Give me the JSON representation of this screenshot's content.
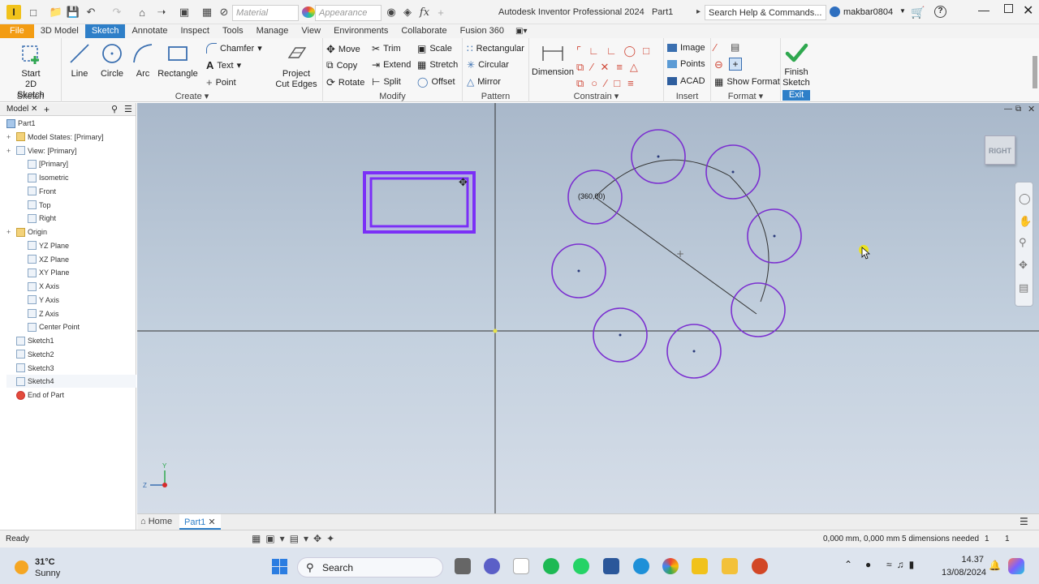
{
  "window": {
    "title": "Autodesk Inventor Professional 2024",
    "doc_name": "Part1",
    "search_placeholder": "Search Help & Commands...",
    "user": "makbar0804",
    "help": "?"
  },
  "quick_access": {
    "material_placeholder": "Material",
    "appearance_placeholder": "Appearance",
    "fx_label": "fx"
  },
  "menu_tabs": [
    "File",
    "3D Model",
    "Sketch",
    "Annotate",
    "Inspect",
    "Tools",
    "Manage",
    "View",
    "Environments",
    "Collaborate",
    "Fusion 360"
  ],
  "ribbon": {
    "sketch_group": {
      "title": "Sketch",
      "start_line1": "Start",
      "start_line2": "2D Sketch"
    },
    "create_group": {
      "title": "Create",
      "line": "Line",
      "circle": "Circle",
      "arc": "Arc",
      "rectangle": "Rectangle",
      "chamfer": "Chamfer",
      "text": "Text",
      "point": "Point",
      "project_line1": "Project",
      "project_line2": "Cut Edges"
    },
    "modify_group": {
      "title": "Modify",
      "move": "Move",
      "copy": "Copy",
      "rotate": "Rotate",
      "trim": "Trim",
      "extend": "Extend",
      "split": "Split",
      "scale": "Scale",
      "stretch": "Stretch",
      "offset": "Offset"
    },
    "pattern_group": {
      "title": "Pattern",
      "rectangular": "Rectangular",
      "circular": "Circular",
      "mirror": "Mirror"
    },
    "constrain_group": {
      "title": "Constrain",
      "dimension": "Dimension"
    },
    "insert_group": {
      "title": "Insert",
      "image": "Image",
      "points": "Points",
      "acad": "ACAD"
    },
    "format_group": {
      "title": "Format",
      "show_format": "Show Format"
    },
    "exit_group": {
      "title": "Exit",
      "finish_line1": "Finish",
      "finish_line2": "Sketch"
    }
  },
  "browser": {
    "tab_label": "Model",
    "items": [
      {
        "label": "Part1",
        "level": 0
      },
      {
        "label": "Model States: [Primary]",
        "level": 1
      },
      {
        "label": "View: [Primary]",
        "level": 1
      },
      {
        "label": "[Primary]",
        "level": 2
      },
      {
        "label": "Isometric",
        "level": 2
      },
      {
        "label": "Front",
        "level": 2
      },
      {
        "label": "Top",
        "level": 2
      },
      {
        "label": "Right",
        "level": 2
      },
      {
        "label": "Origin",
        "level": 1
      },
      {
        "label": "YZ Plane",
        "level": 2
      },
      {
        "label": "XZ Plane",
        "level": 2
      },
      {
        "label": "XY Plane",
        "level": 2
      },
      {
        "label": "X Axis",
        "level": 2
      },
      {
        "label": "Y Axis",
        "level": 2
      },
      {
        "label": "Z Axis",
        "level": 2
      },
      {
        "label": "Center Point",
        "level": 2
      },
      {
        "label": "Sketch1",
        "level": 1
      },
      {
        "label": "Sketch2",
        "level": 1
      },
      {
        "label": "Sketch3",
        "level": 1
      },
      {
        "label": "Sketch4",
        "level": 1
      },
      {
        "label": "End of Part",
        "level": 1
      }
    ]
  },
  "viewport": {
    "viewcube_label": "RIGHT",
    "coord_label": "(360,00)",
    "triad_y": "Y",
    "triad_z": "Z"
  },
  "doc_tabs": {
    "home": "Home",
    "part": "Part1"
  },
  "status": {
    "ready": "Ready",
    "coords": "0,000 mm, 0,000 mm",
    "dims_needed": "5 dimensions needed",
    "count1": "1",
    "count2": "1"
  },
  "taskbar": {
    "weather_temp": "31°C",
    "weather_desc": "Sunny",
    "search": "Search",
    "time": "14.37",
    "date": "13/08/2024"
  },
  "colors": {
    "accent": "#2e7fc8",
    "file_tab": "#f39c12",
    "sketch_purple": "#7b2ff7",
    "finish_green": "#2fa84f"
  }
}
